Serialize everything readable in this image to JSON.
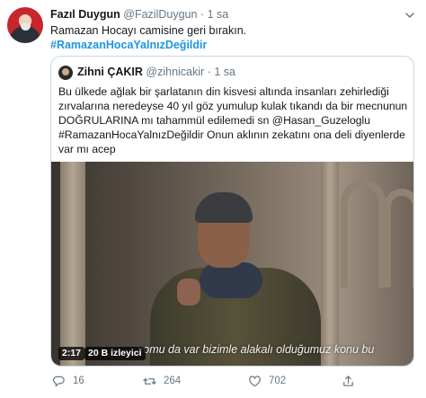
{
  "tweet": {
    "author_name": "Fazıl Duygun",
    "handle": "@FazilDuygun",
    "separator": "·",
    "time": "1 sa",
    "text": "Ramazan Hocayı camisine geri bırakın.",
    "hashtag": "#RamazanHocaYalnızDeğildir"
  },
  "quote": {
    "author_name": "Zihni ÇAKIR",
    "handle": "@zihnicakir",
    "separator": "·",
    "time": "1 sa",
    "text": "Bu ülkede ağlak bir şarlatanın din kisvesi altında insanları zehirlediği zırvalarına neredeyse 40 yıl göz yumulup kulak tıkandı da bir mecnunun DOĞRULARINA mı tahammül edilemedi sn @Hasan_Guzeloglu #RamazanHocaYalnızDeğildir Onun aklının zekatını ona deli diyenlerde var mı acep",
    "video": {
      "duration": "2:17",
      "views": "20 B izleyici",
      "subtitle": "yomu da var bizimle alakalı olduğumuz konu bu"
    }
  },
  "actions": {
    "reply_count": "16",
    "retweet_count": "264",
    "like_count": "702"
  },
  "icons": {
    "reply": "reply-icon",
    "retweet": "retweet-icon",
    "like": "heart-icon",
    "share": "share-icon",
    "more": "chevron-down-icon"
  },
  "colors": {
    "link": "#1b95e0",
    "muted": "#657786",
    "text": "#14171a",
    "border": "#ccd6dd"
  }
}
